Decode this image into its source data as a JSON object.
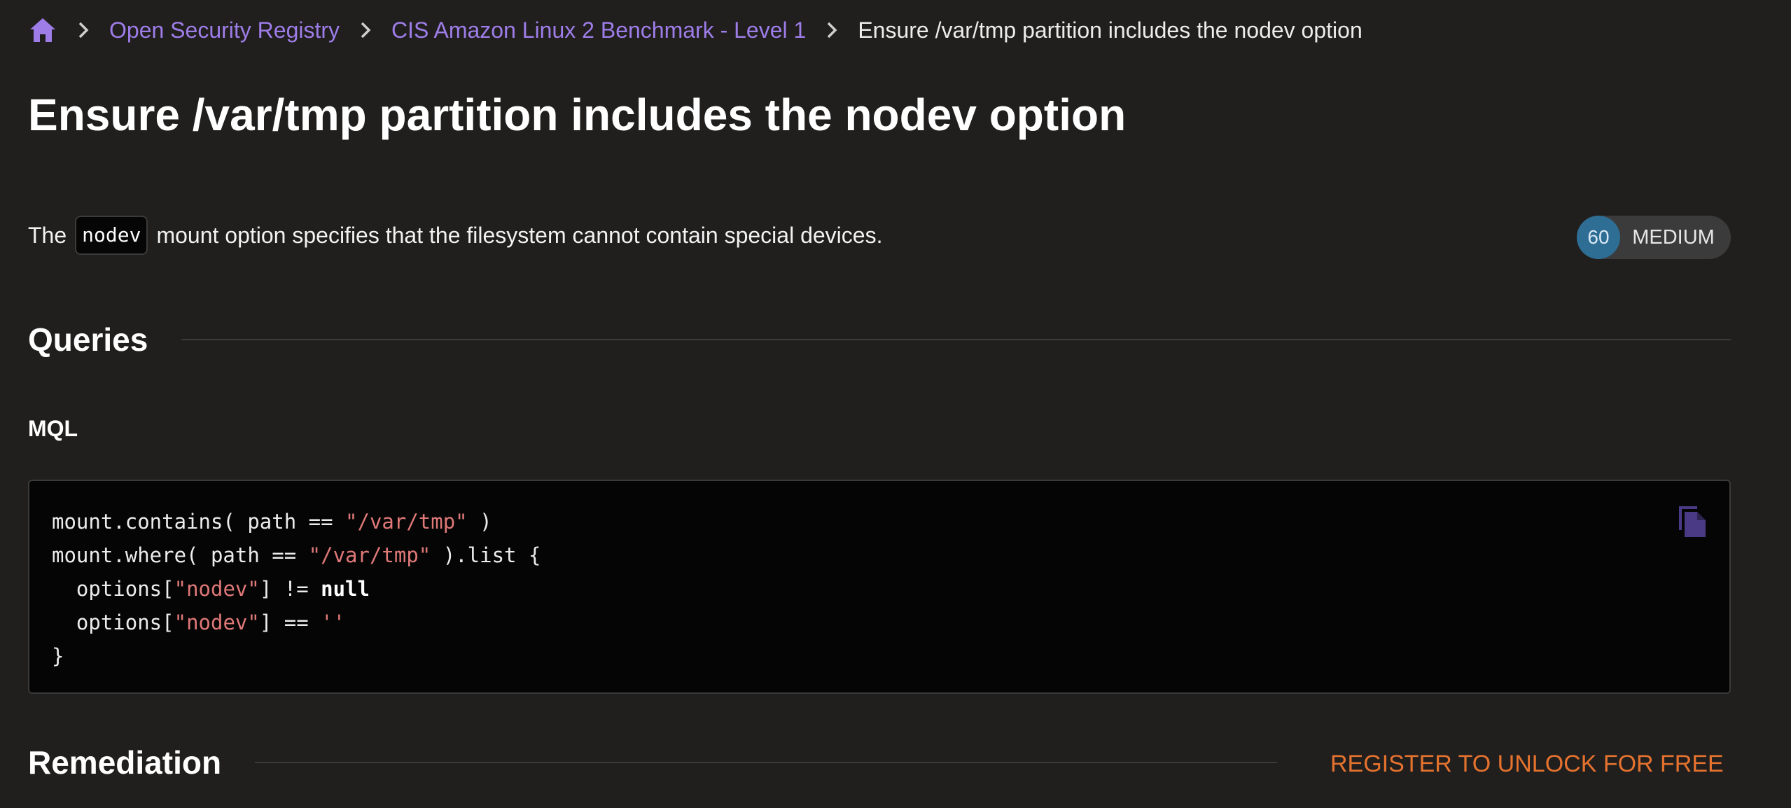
{
  "breadcrumb": {
    "home_icon": "home-icon",
    "items": [
      {
        "label": "Open Security Registry"
      },
      {
        "label": "CIS Amazon Linux 2 Benchmark - Level 1"
      }
    ],
    "current": "Ensure /var/tmp partition includes the nodev option"
  },
  "page": {
    "title": "Ensure /var/tmp partition includes the nodev option"
  },
  "description": {
    "prefix": "The",
    "code": "nodev",
    "suffix": "mount option specifies that the filesystem cannot contain special devices."
  },
  "severity": {
    "score": "60",
    "label": "MEDIUM",
    "color": "#2e6d94"
  },
  "queries": {
    "heading": "Queries",
    "language": "MQL",
    "copy_icon": "copy-icon",
    "code_lines": [
      [
        {
          "t": "mount.contains( path == ",
          "k": "plain"
        },
        {
          "t": "\"/var/tmp\"",
          "k": "str"
        },
        {
          "t": " )",
          "k": "plain"
        }
      ],
      [
        {
          "t": "mount.where( path == ",
          "k": "plain"
        },
        {
          "t": "\"/var/tmp\"",
          "k": "str"
        },
        {
          "t": " ).list {",
          "k": "plain"
        }
      ],
      [
        {
          "t": "  options[",
          "k": "plain"
        },
        {
          "t": "\"nodev\"",
          "k": "str"
        },
        {
          "t": "] != ",
          "k": "plain"
        },
        {
          "t": "null",
          "k": "kw"
        }
      ],
      [
        {
          "t": "  options[",
          "k": "plain"
        },
        {
          "t": "\"nodev\"",
          "k": "str"
        },
        {
          "t": "] == ",
          "k": "plain"
        },
        {
          "t": "''",
          "k": "str"
        }
      ],
      [
        {
          "t": "}",
          "k": "plain"
        }
      ]
    ]
  },
  "remediation": {
    "heading": "Remediation",
    "unlock_label": "REGISTER TO UNLOCK FOR FREE"
  },
  "colors": {
    "accent": "#9e7de8",
    "string": "#e07878",
    "unlock": "#e5722e",
    "background": "#201f1e"
  }
}
